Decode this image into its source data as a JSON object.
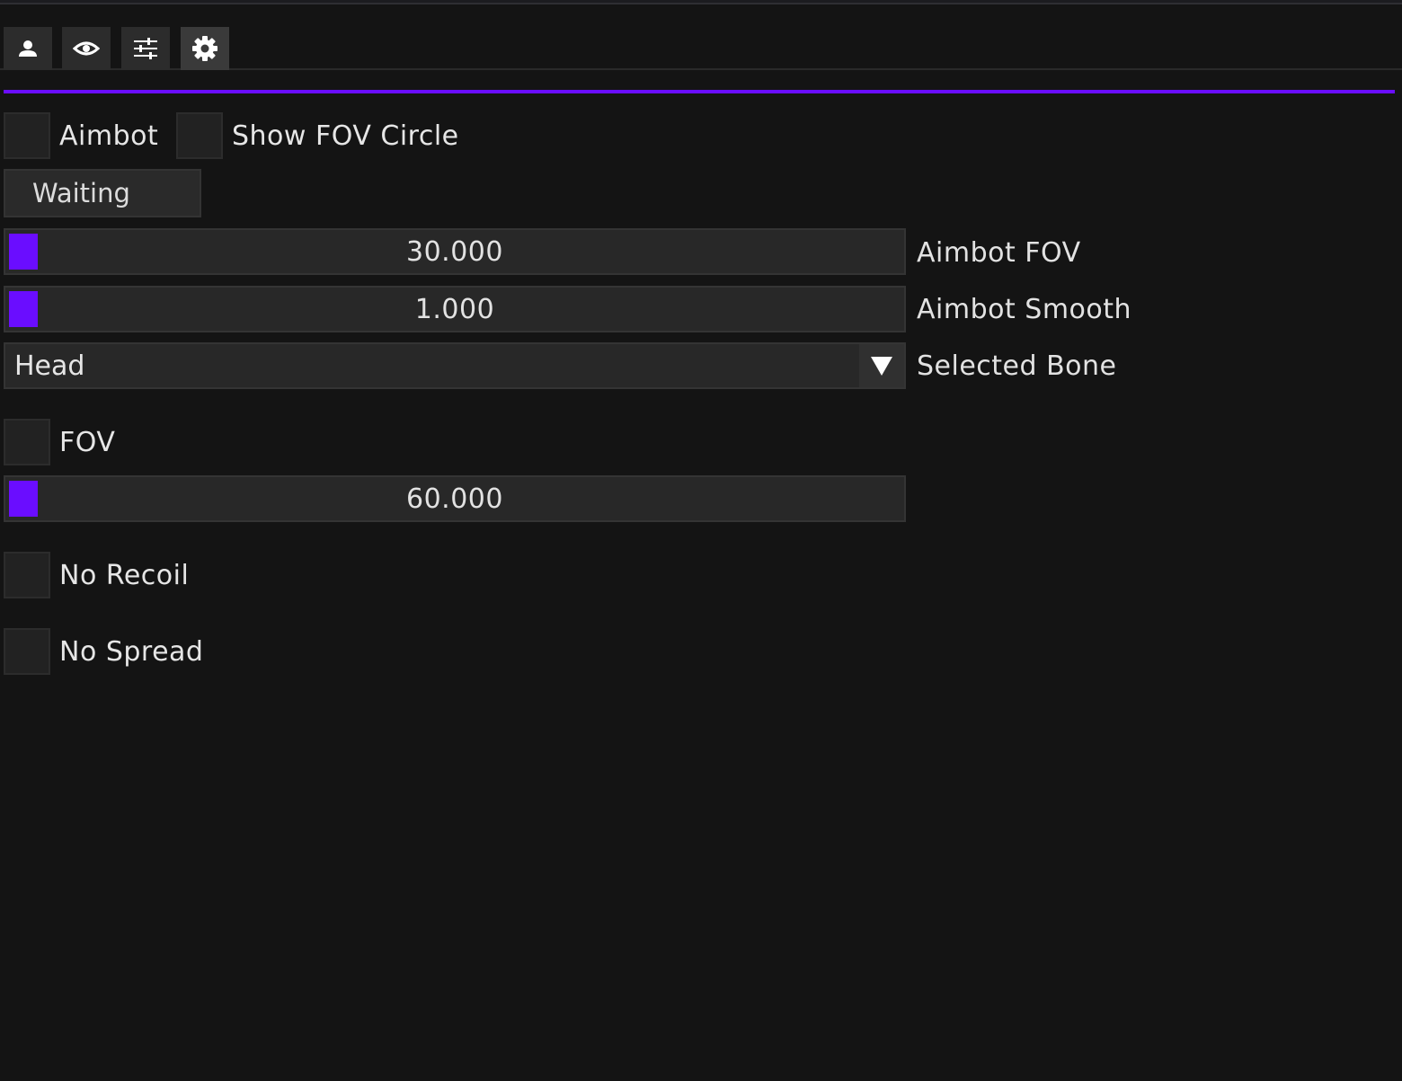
{
  "theme": {
    "accent": "#6a0dff",
    "background": "#141414"
  },
  "tabs": [
    {
      "icon": "user-icon"
    },
    {
      "icon": "eye-icon"
    },
    {
      "icon": "sliders-icon"
    },
    {
      "icon": "gear-icon",
      "active": true
    }
  ],
  "aimbot": {
    "enabled_label": "Aimbot",
    "show_fov_circle_label": "Show FOV Circle",
    "hotkey_button_label": "Waiting",
    "fov_slider": {
      "value": "30.000",
      "label": "Aimbot FOV"
    },
    "smooth_slider": {
      "value": "1.000",
      "label": "Aimbot Smooth"
    },
    "bone_select": {
      "selected": "Head",
      "label": "Selected Bone"
    }
  },
  "fov": {
    "enabled_label": "FOV",
    "fov_slider": {
      "value": "60.000"
    }
  },
  "misc": {
    "no_recoil_label": "No Recoil",
    "no_spread_label": "No Spread"
  }
}
